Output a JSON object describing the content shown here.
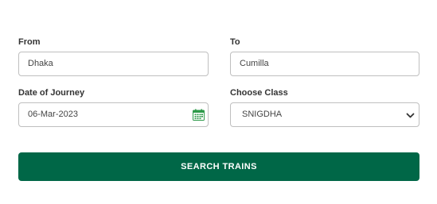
{
  "form": {
    "from": {
      "label": "From",
      "value": "Dhaka"
    },
    "to": {
      "label": "To",
      "value": "Cumilla"
    },
    "date": {
      "label": "Date of Journey",
      "value": "06-Mar-2023",
      "icon": "calendar-icon"
    },
    "class": {
      "label": "Choose Class",
      "selected": "SNIGDHA",
      "icon": "chevron-down-icon"
    },
    "search_button": {
      "label": "SEARCH TRAINS"
    }
  },
  "colors": {
    "accent": "#006747",
    "calendar_icon": "#2e9a4a",
    "label_text": "#333333",
    "field_border": "#bfbfbf"
  }
}
